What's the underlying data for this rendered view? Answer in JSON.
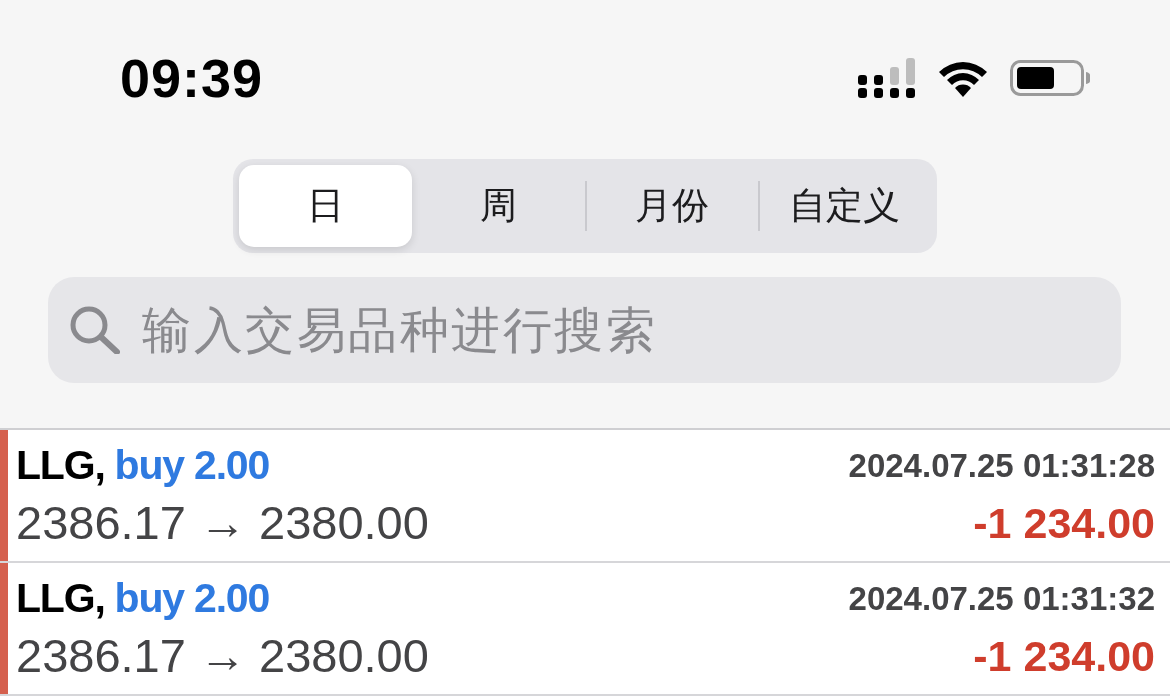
{
  "status_bar": {
    "time": "09:39"
  },
  "period_tabs": [
    {
      "label": "日",
      "selected": true
    },
    {
      "label": "周",
      "selected": false
    },
    {
      "label": "月份",
      "selected": false
    },
    {
      "label": "自定义",
      "selected": false
    }
  ],
  "search": {
    "placeholder": "输入交易品种进行搜索"
  },
  "trades": [
    {
      "symbol": "LLG,",
      "order": "buy 2.00",
      "time": "2024.07.25 01:31:28",
      "prices": "2386.17 → 2380.00",
      "profit": "-1 234.00",
      "color": "#d5604e"
    },
    {
      "symbol": "LLG,",
      "order": "buy 2.00",
      "time": "2024.07.25 01:31:32",
      "prices": "2386.17 → 2380.00",
      "profit": "-1 234.00",
      "color": "#d5604e"
    }
  ]
}
